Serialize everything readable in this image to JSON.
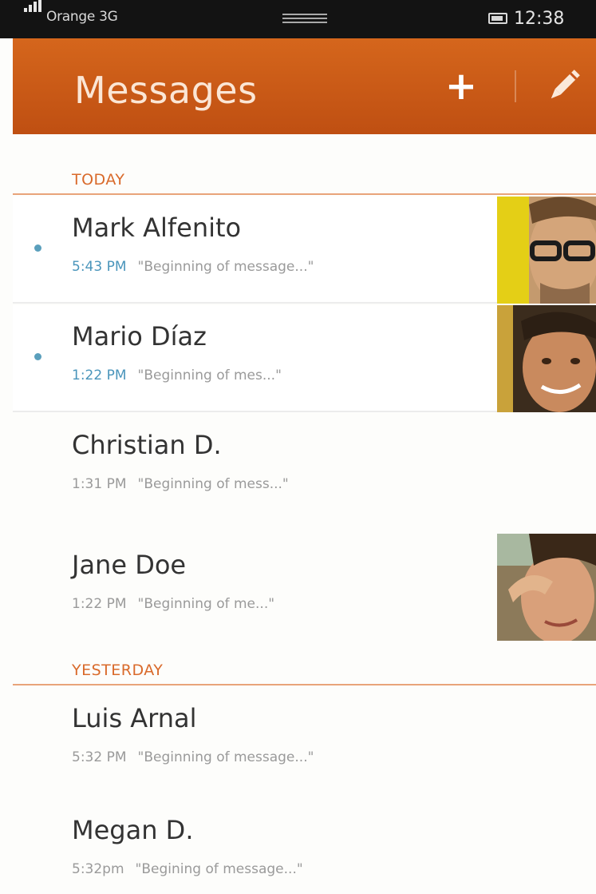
{
  "status_bar": {
    "carrier": "Orange 3G",
    "time": "12:38"
  },
  "header": {
    "title": "Messages",
    "add_label": "+"
  },
  "sections": [
    {
      "label": "TODAY"
    },
    {
      "label": "YESTERDAY"
    }
  ],
  "messages": [
    {
      "name": "Mark Alfenito",
      "time": "5:43 PM",
      "preview": "\"Beginning of message...\"",
      "unread": true,
      "avatar": "photo-man-glasses"
    },
    {
      "name": "Mario Díaz",
      "time": "1:22 PM",
      "preview": "\"Beginning of mes...\"",
      "unread": true,
      "avatar": "photo-man-smiling"
    },
    {
      "name": "Christian D.",
      "time": "1:31 PM",
      "preview": "\"Beginning of mess...\"",
      "unread": false,
      "avatar": null
    },
    {
      "name": "Jane Doe",
      "time": "1:22 PM",
      "preview": "\"Beginning of me...\"",
      "unread": false,
      "avatar": "photo-woman"
    },
    {
      "name": "Luis Arnal",
      "time": "5:32 PM",
      "preview": "\"Beginning of message...\"",
      "unread": false,
      "avatar": null
    },
    {
      "name": "Megan D.",
      "time": "5:32pm",
      "preview": "\"Begining of message...\"",
      "unread": false,
      "avatar": null
    }
  ],
  "colors": {
    "accent": "#cc5b17",
    "section_label": "#d96a2b",
    "unread_time": "#4a95bb",
    "unread_dot": "#5a9fbc"
  }
}
